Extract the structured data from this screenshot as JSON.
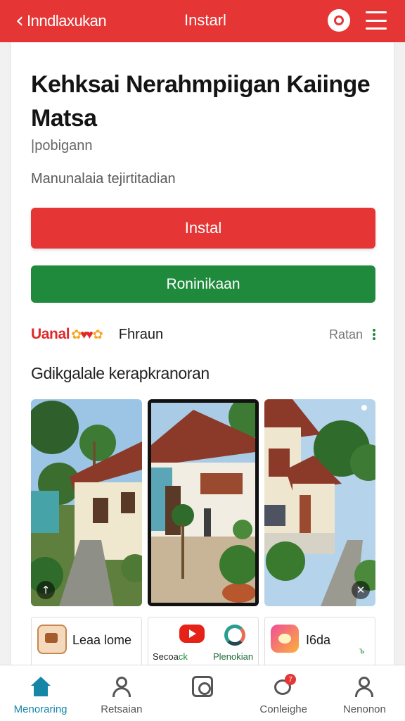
{
  "header": {
    "back_label": "Inndlaxukan",
    "title": "Instarl",
    "back_icon": "chevron-left-icon",
    "chat_icon": "chat-bubble-icon",
    "menu_icon": "hamburger-menu-icon",
    "color": "#e53535"
  },
  "main": {
    "title": "Kehksai Nerahmpiigan Kaiinge Matsa",
    "subtitle": "|pobigann",
    "description": "Manunalaia tejirtitadian",
    "install_label": "Instal",
    "recommend_label": "Roninikaan",
    "install_color": "#e53535",
    "recommend_color": "#1f8a3c"
  },
  "meta": {
    "brand": "Uanal",
    "label": "Fhraun",
    "rating": "Ratan",
    "more_icon": "vertical-dots-icon"
  },
  "gallery": {
    "title": "Gdikgalale kerapkranoran",
    "badge_left": "↑",
    "badge_right": "✕"
  },
  "apps": [
    {
      "name": "Leaa lome",
      "icon": "app-icon-brown"
    },
    {
      "caption_left": "Secoa",
      "caption_left_mark": "ck",
      "caption_right": "Plenokian",
      "icon": "play-icon"
    },
    {
      "name": "I6da",
      "mark": "ъ",
      "icon": "app-icon-gradient"
    }
  ],
  "nav": [
    {
      "label": "Menoraring",
      "icon": "home-icon",
      "active": true
    },
    {
      "label": "Retsaian",
      "icon": "user-icon",
      "active": false
    },
    {
      "label": "",
      "icon": "camera-icon",
      "active": false
    },
    {
      "label": "Conleighe",
      "icon": "chat-icon",
      "badge": "7",
      "active": false
    },
    {
      "label": "Nenonon",
      "icon": "profile-icon",
      "active": false
    }
  ]
}
